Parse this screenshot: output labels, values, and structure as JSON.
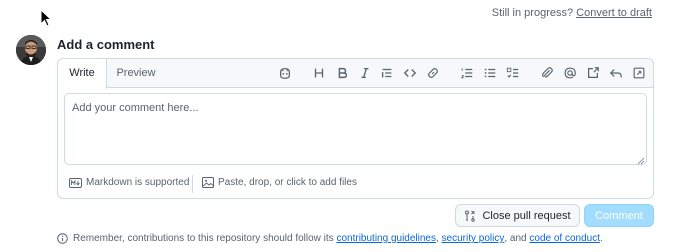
{
  "draft": {
    "prompt": "Still in progress?",
    "link": "Convert to draft"
  },
  "comment": {
    "heading": "Add a comment",
    "tabs": {
      "write": "Write",
      "preview": "Preview"
    },
    "toolbar_icons": [
      "copilot-icon",
      "heading-icon",
      "bold-icon",
      "italic-icon",
      "quote-icon",
      "code-icon",
      "link-icon",
      "numbered-list-icon",
      "unordered-list-icon",
      "task-list-icon",
      "attach-icon",
      "mention-icon",
      "reference-icon",
      "saved-reply-icon",
      "fullscreen-icon"
    ],
    "placeholder": "Add your comment here...",
    "markdown_note": "Markdown is supported",
    "attach_note": "Paste, drop, or click to add files"
  },
  "actions": {
    "close_label": "Close pull request",
    "comment_label": "Comment"
  },
  "notice": {
    "text_before": "Remember, contributions to this repository should follow its",
    "link1": "contributing guidelines",
    "sep1": ",",
    "link2": "security policy",
    "sep2": ", and",
    "link3": "code of conduct",
    "end": "."
  },
  "colors": {
    "accent_link": "#0969da",
    "comment_button_disabled": "#a2dcfe",
    "border": "#d1d9e0",
    "muted_text": "#59636e"
  }
}
